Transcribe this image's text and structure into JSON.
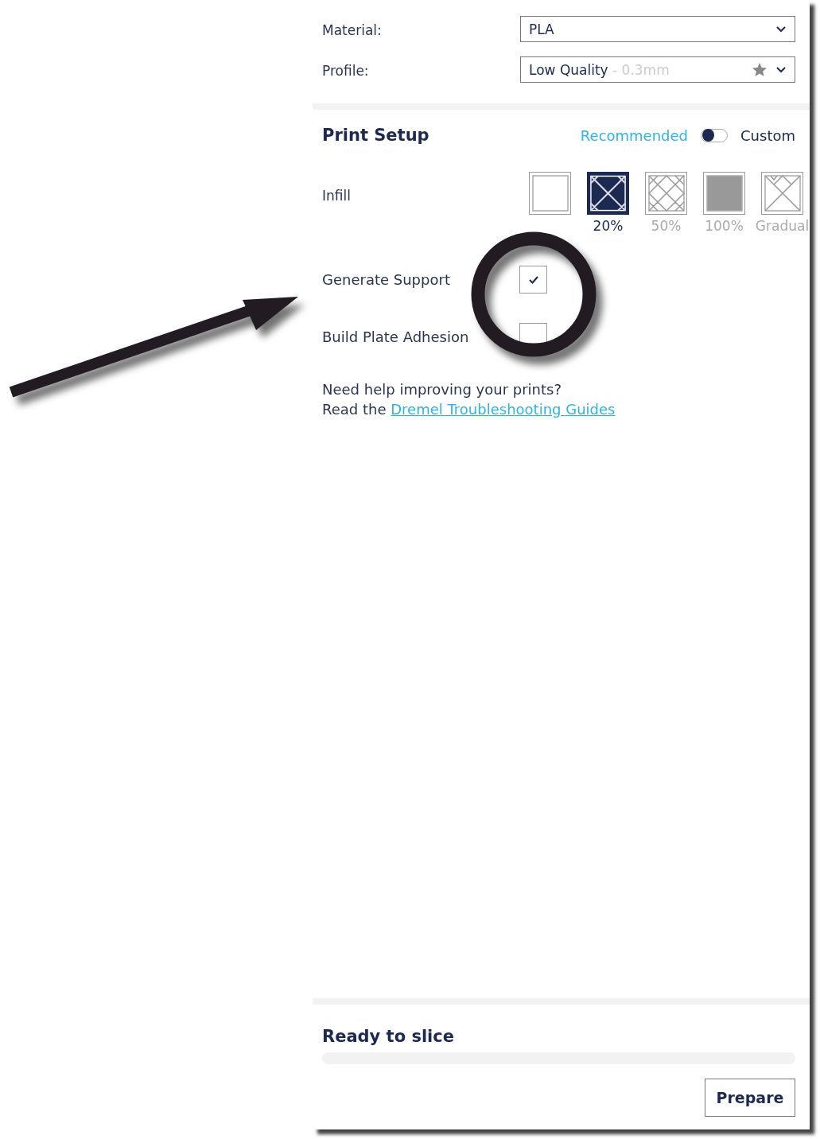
{
  "material": {
    "label": "Material:",
    "value": "PLA"
  },
  "profile": {
    "label": "Profile:",
    "value": "Low Quality",
    "detail": "- 0.3mm"
  },
  "print_setup": {
    "title": "Print Setup",
    "recommended_label": "Recommended",
    "custom_label": "Custom",
    "custom_mode": false
  },
  "infill": {
    "label": "Infill",
    "options": [
      {
        "kind": "empty",
        "selected": false
      },
      {
        "kind": "sparse",
        "label": "20%",
        "selected": true
      },
      {
        "kind": "dense",
        "label": "50%",
        "selected": false
      },
      {
        "kind": "solid",
        "label": "100%",
        "selected": false
      },
      {
        "kind": "gradual",
        "label": "Gradual",
        "selected": false
      }
    ]
  },
  "settings": [
    {
      "label": "Generate Support",
      "checked": true
    },
    {
      "label": "Build Plate Adhesion",
      "checked": false
    }
  ],
  "help": {
    "line1": "Need help improving your prints?",
    "line2": "Read the",
    "link": "Dremel Troubleshooting Guides"
  },
  "status": {
    "title": "Ready to slice",
    "level": 0
  },
  "prepare_button": "Prepare"
}
